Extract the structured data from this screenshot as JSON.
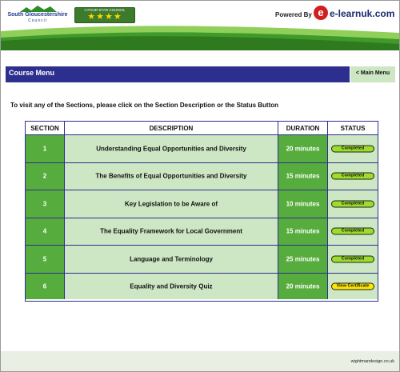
{
  "header": {
    "council_name": "South Gloucestershire",
    "council_sub": "Council",
    "badge_top": "A FOUR STAR COUNCIL",
    "badge_stars": "★★★★",
    "powered_by": "Powered By",
    "brand_e": "e",
    "brand_text": "e-learnuk.com"
  },
  "titlebar": {
    "title": "Course Menu",
    "main_menu": "< Main Menu"
  },
  "instruction": "To visit any of the Sections, please click on the Section Description or the Status Button",
  "table": {
    "headers": [
      "SECTION",
      "DESCRIPTION",
      "DURATION",
      "STATUS"
    ],
    "rows": [
      {
        "section": "1",
        "description": "Understanding Equal Opportunities and Diversity",
        "duration": "20 minutes",
        "status": "Completed"
      },
      {
        "section": "2",
        "description": "The Benefits of Equal Opportunities and Diversity",
        "duration": "15 minutes",
        "status": "Completed"
      },
      {
        "section": "3",
        "description": "Key Legislation to be Aware of",
        "duration": "10 minutes",
        "status": "Completed"
      },
      {
        "section": "4",
        "description": "The Equality Framework for Local Government",
        "duration": "15 minutes",
        "status": "Completed"
      },
      {
        "section": "5",
        "description": "Language and Terminology",
        "duration": "25 minutes",
        "status": "Completed"
      },
      {
        "section": "6",
        "description": "Equality and Diversity Quiz",
        "duration": "20 minutes",
        "status": "View Certificate"
      }
    ]
  },
  "footer": {
    "credit": "wightmandesign.co.uk"
  },
  "colors": {
    "brand_navy": "#2d2f8f",
    "green_dark": "#56ac3c",
    "green_light": "#cde6c3",
    "status_completed": "#9bdd2a",
    "status_certificate": "#ffe600"
  }
}
